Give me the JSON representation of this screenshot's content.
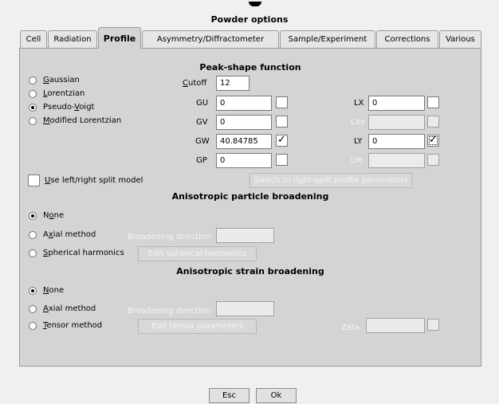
{
  "dialog": {
    "title": "Powder options"
  },
  "tabs": [
    "Cell",
    "Radiation",
    "Profile",
    "Asymmetry/Diffractometer",
    "Sample/Experiment",
    "Corrections",
    "Various"
  ],
  "peak": {
    "title": "Peak-shape function",
    "functions": [
      {
        "label_u": "G",
        "label_rest": "aussian",
        "selected": false
      },
      {
        "label_u": "L",
        "label_rest": "orentzian",
        "selected": false
      },
      {
        "label_pre": "Pseudo-",
        "label_u": "V",
        "label_rest": "oigt",
        "selected": true
      },
      {
        "label_u": "M",
        "label_rest": "odified Lorentzian",
        "selected": false
      }
    ],
    "cutoff_label_u": "C",
    "cutoff_label_rest": "utoff",
    "cutoff_value": "12",
    "params_left": [
      {
        "label": "GU",
        "value": "0",
        "refine": ""
      },
      {
        "label": "GV",
        "value": "0",
        "refine": ""
      },
      {
        "label": "GW",
        "value": "40.84785",
        "refine": "✓"
      },
      {
        "label": "GP",
        "value": "0",
        "refine": ""
      }
    ],
    "params_right": [
      {
        "label": "LX",
        "value": "0",
        "refine": ""
      },
      {
        "label": "LXe",
        "value": "",
        "refine": ""
      },
      {
        "label": "LY",
        "value": "0",
        "refine": "✓"
      },
      {
        "label": "LYe",
        "value": "",
        "refine": ""
      }
    ],
    "split_label_u": "U",
    "split_label_rest": "se left/right split model",
    "split_button": "Switch to right-split profile parameters"
  },
  "particle": {
    "title": "Anisotropic particle broadening",
    "options": [
      {
        "label_pre": "N",
        "label_u": "o",
        "label_rest": "ne",
        "selected": true
      },
      {
        "label_pre": "A",
        "label_u": "x",
        "label_rest": "ial method",
        "selected": false
      },
      {
        "label_u": "S",
        "label_rest": "pherical harmonics",
        "selected": false
      }
    ],
    "direction_label": "Broadening direction",
    "direction_value": "",
    "edit_button": "Edit spherical harmonics"
  },
  "strain": {
    "title": "Anisotropic strain broadening",
    "options": [
      {
        "label_u": "N",
        "label_rest": "one",
        "selected": true
      },
      {
        "label_u": "A",
        "label_rest": "xial method",
        "selected": false
      },
      {
        "label_u": "T",
        "label_rest": "ensor method",
        "selected": false
      }
    ],
    "direction_label": "Broadening direction",
    "direction_value": "",
    "edit_button": "Edit tensor parameters",
    "zeta_label": "Zeta",
    "zeta_value": ""
  },
  "footer": {
    "esc": "Esc",
    "ok": "Ok"
  }
}
